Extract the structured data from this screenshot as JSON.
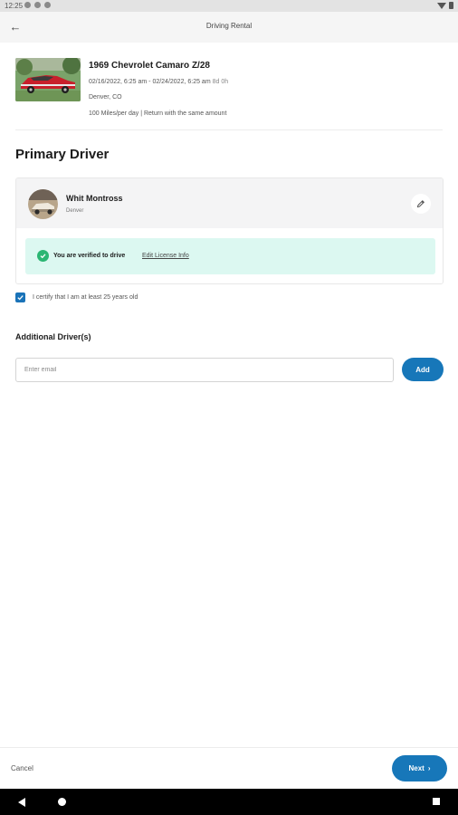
{
  "status_bar": {
    "time": "12:25"
  },
  "app_bar": {
    "title": "Driving Rental"
  },
  "car": {
    "title": "1969 Chevrolet Camaro Z/28",
    "dates": "02/16/2022, 6:25 am - 02/24/2022, 6:25 am",
    "duration": "8d 0h",
    "location": "Denver, CO",
    "miles": "100 Miles/per day | Return with the same amount"
  },
  "primary_driver": {
    "heading": "Primary Driver",
    "name": "Whit Montross",
    "city": "Denver",
    "verified_text": "You are verified to drive",
    "edit_license_link": "Edit License Info"
  },
  "certify": {
    "label": "I certify that I am at least 25 years old",
    "checked": true
  },
  "additional": {
    "heading": "Additional Driver(s)",
    "email_placeholder": "Enter email",
    "email_value": "",
    "add_label": "Add"
  },
  "footer": {
    "cancel_label": "Cancel",
    "next_label": "Next"
  },
  "colors": {
    "accent": "#1777b9",
    "verified_bg": "#dcf8f1",
    "verified_check": "#2bb673"
  }
}
